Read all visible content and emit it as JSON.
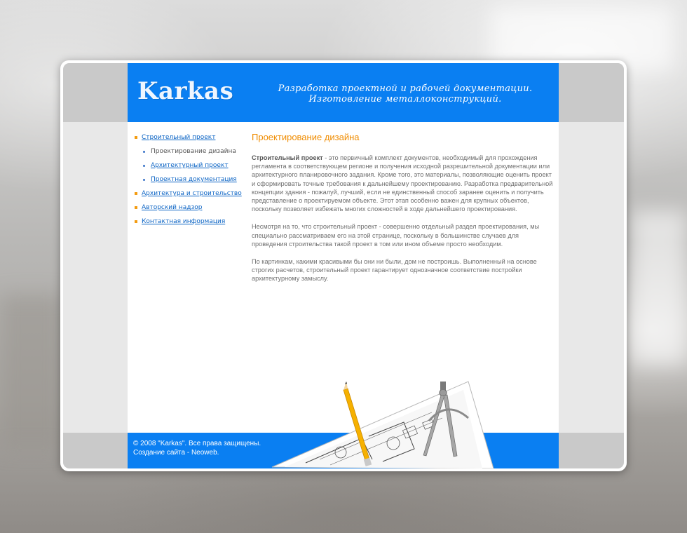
{
  "header": {
    "logo": "Karkas",
    "tagline_line1": "Разработка проектной и рабочей документации.",
    "tagline_line2": "Изготовление металлоконструкций."
  },
  "nav": {
    "items": [
      {
        "label": "Строительный проект"
      },
      {
        "label": "Архитектура и строительство"
      },
      {
        "label": "Авторский надзор"
      },
      {
        "label": "Контактная информация"
      }
    ],
    "subitems": [
      {
        "label": "Проектирование дизайна",
        "current": true
      },
      {
        "label": "Архитектурный проект"
      },
      {
        "label": "Проектная документация"
      }
    ]
  },
  "article": {
    "title": "Проектирование дизайна",
    "p1_bold": "Строительный проект",
    "p1_rest": " - это первичный комплект документов, необходимый для прохождения регламента в соответствующем регионе и получения исходной разрешительной документации или архитектурного планировочного задания. Кроме того, это материалы, позволяющие оценить проект и сформировать точные требования к дальнейшему проектированию. Разработка предварительной концепции здания - пожалуй, лучший, если не единственный способ заранее оценить и получить представление о проектируемом объекте. Этот этап особенно важен для крупных объектов, поскольку позволяет избежать многих сложностей в ходе дальнейшего проектирования.",
    "p2": "Несмотря на то, что строительный проект - совершенно отдельный раздел проектирования, мы специально рассматриваем его на этой странице, поскольку в большинстве случаев для проведения строительства такой проект в том или ином объеме просто необходим.",
    "p3": "По картинкам, какими красивыми бы они ни были, дом не построишь. Выполненный на основе строгих расчетов, строительный проект гарантирует однозначное соответствие постройки архитектурному замыслу."
  },
  "footer": {
    "copyright": "© 2008 \"Karkas\". Все права защищены.",
    "credit_prefix": "Создание сайта - ",
    "credit_link": "Neoweb",
    "credit_suffix": "."
  },
  "colors": {
    "brand_blue": "#0a7ff2",
    "accent_orange": "#f08c00",
    "link_blue": "#0a63c4"
  }
}
